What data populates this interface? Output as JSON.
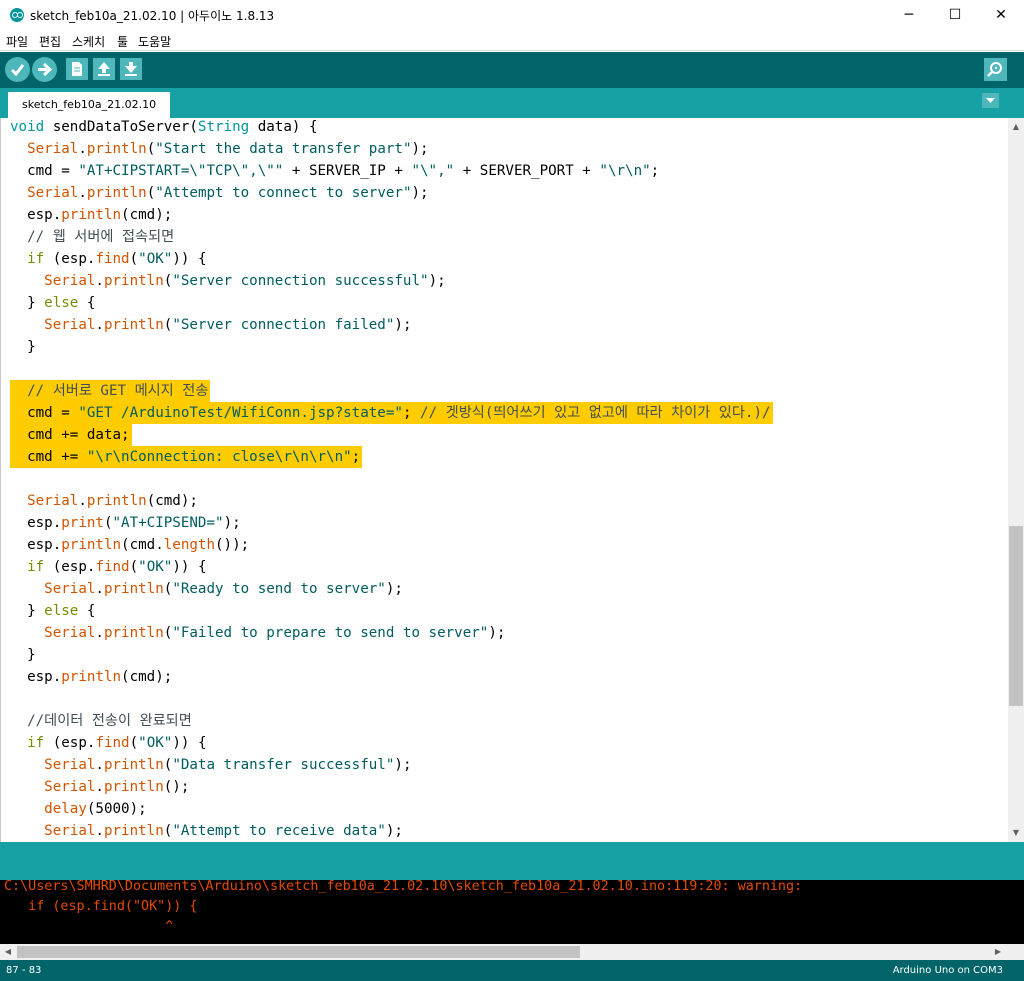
{
  "window": {
    "title": "sketch_feb10a_21.02.10 | 아두이노 1.8.13",
    "minimize": "─",
    "maximize": "☐",
    "close": "✕"
  },
  "menu": [
    "파일",
    "편집",
    "스케치",
    "툴",
    "도움말"
  ],
  "toolbar": {
    "verify_icon": "✔",
    "upload_icon": "➜",
    "new_icon": "new-file-icon",
    "open_icon": "open-icon",
    "save_icon": "save-icon",
    "serial_monitor_icon": "magnifier-icon"
  },
  "tab": {
    "label": "sketch_feb10a_21.02.10"
  },
  "code_lines": [
    [
      [
        "void",
        "#00979c"
      ],
      [
        " sendDataToServer(",
        "#000000"
      ],
      [
        "String",
        "#00979c"
      ],
      [
        " data) {",
        "#000000"
      ]
    ],
    [
      [
        "  ",
        "#000000"
      ],
      [
        "Serial",
        "#d35400"
      ],
      [
        ".",
        "#000000"
      ],
      [
        "println",
        "#d35400"
      ],
      [
        "(",
        "#000000"
      ],
      [
        "\"Start the data transfer part\"",
        "#005c5f"
      ],
      [
        ");",
        "#000000"
      ]
    ],
    [
      [
        "  cmd = ",
        "#000000"
      ],
      [
        "\"AT+CIPSTART=\\\"TCP\\\",\\\"\"",
        "#005c5f"
      ],
      [
        " + SERVER_IP + ",
        "#000000"
      ],
      [
        "\"\\\",\"",
        "#005c5f"
      ],
      [
        " + SERVER_PORT + ",
        "#000000"
      ],
      [
        "\"\\r\\n\"",
        "#005c5f"
      ],
      [
        ";",
        "#000000"
      ]
    ],
    [
      [
        "  ",
        "#000000"
      ],
      [
        "Serial",
        "#d35400"
      ],
      [
        ".",
        "#000000"
      ],
      [
        "println",
        "#d35400"
      ],
      [
        "(",
        "#000000"
      ],
      [
        "\"Attempt to connect to server\"",
        "#005c5f"
      ],
      [
        ");",
        "#000000"
      ]
    ],
    [
      [
        "  esp.",
        "#000000"
      ],
      [
        "println",
        "#d35400"
      ],
      [
        "(cmd);",
        "#000000"
      ]
    ],
    [
      [
        "  // 웹 서버에 접속되면",
        "#434f54"
      ]
    ],
    [
      [
        "  ",
        "#000000"
      ],
      [
        "if",
        "#728e00"
      ],
      [
        " (esp.",
        "#000000"
      ],
      [
        "find",
        "#d35400"
      ],
      [
        "(",
        "#000000"
      ],
      [
        "\"OK\"",
        "#005c5f"
      ],
      [
        ")) {",
        "#000000"
      ]
    ],
    [
      [
        "    ",
        "#000000"
      ],
      [
        "Serial",
        "#d35400"
      ],
      [
        ".",
        "#000000"
      ],
      [
        "println",
        "#d35400"
      ],
      [
        "(",
        "#000000"
      ],
      [
        "\"Server connection successful\"",
        "#005c5f"
      ],
      [
        ");",
        "#000000"
      ]
    ],
    [
      [
        "  } ",
        "#000000"
      ],
      [
        "else",
        "#728e00"
      ],
      [
        " {",
        "#000000"
      ]
    ],
    [
      [
        "    ",
        "#000000"
      ],
      [
        "Serial",
        "#d35400"
      ],
      [
        ".",
        "#000000"
      ],
      [
        "println",
        "#d35400"
      ],
      [
        "(",
        "#000000"
      ],
      [
        "\"Server connection failed\"",
        "#005c5f"
      ],
      [
        ");",
        "#000000"
      ]
    ],
    [
      [
        "  }",
        "#000000"
      ]
    ],
    [
      [
        "",
        "#000000"
      ]
    ],
    [
      [
        "  // 서버로 GET 메시지 전송",
        "#434f54"
      ]
    ],
    [
      [
        "  cmd = ",
        "#000000"
      ],
      [
        "\"GET /ArduinoTest/WifiConn.jsp?state=\"",
        "#005c5f"
      ],
      [
        "; ",
        "#000000"
      ],
      [
        "// 겟방식(띄어쓰기 있고 없고에 따라 차이가 있다.)/",
        "#434f54"
      ]
    ],
    [
      [
        "  cmd += data;",
        "#000000"
      ]
    ],
    [
      [
        "  cmd += ",
        "#000000"
      ],
      [
        "\"\\r\\nConnection: close\\r\\n\\r\\n\"",
        "#005c5f"
      ],
      [
        ";",
        "#000000"
      ]
    ],
    [
      [
        "",
        "#000000"
      ]
    ],
    [
      [
        "  ",
        "#000000"
      ],
      [
        "Serial",
        "#d35400"
      ],
      [
        ".",
        "#000000"
      ],
      [
        "println",
        "#d35400"
      ],
      [
        "(cmd);",
        "#000000"
      ]
    ],
    [
      [
        "  esp.",
        "#000000"
      ],
      [
        "print",
        "#d35400"
      ],
      [
        "(",
        "#000000"
      ],
      [
        "\"AT+CIPSEND=\"",
        "#005c5f"
      ],
      [
        ");",
        "#000000"
      ]
    ],
    [
      [
        "  esp.",
        "#000000"
      ],
      [
        "println",
        "#d35400"
      ],
      [
        "(cmd.",
        "#000000"
      ],
      [
        "length",
        "#d35400"
      ],
      [
        "());",
        "#000000"
      ]
    ],
    [
      [
        "  ",
        "#000000"
      ],
      [
        "if",
        "#728e00"
      ],
      [
        " (esp.",
        "#000000"
      ],
      [
        "find",
        "#d35400"
      ],
      [
        "(",
        "#000000"
      ],
      [
        "\"OK\"",
        "#005c5f"
      ],
      [
        ")) {",
        "#000000"
      ]
    ],
    [
      [
        "    ",
        "#000000"
      ],
      [
        "Serial",
        "#d35400"
      ],
      [
        ".",
        "#000000"
      ],
      [
        "println",
        "#d35400"
      ],
      [
        "(",
        "#000000"
      ],
      [
        "\"Ready to send to server\"",
        "#005c5f"
      ],
      [
        ");",
        "#000000"
      ]
    ],
    [
      [
        "  } ",
        "#000000"
      ],
      [
        "else",
        "#728e00"
      ],
      [
        " {",
        "#000000"
      ]
    ],
    [
      [
        "    ",
        "#000000"
      ],
      [
        "Serial",
        "#d35400"
      ],
      [
        ".",
        "#000000"
      ],
      [
        "println",
        "#d35400"
      ],
      [
        "(",
        "#000000"
      ],
      [
        "\"Failed to prepare to send to server\"",
        "#005c5f"
      ],
      [
        ");",
        "#000000"
      ]
    ],
    [
      [
        "  }",
        "#000000"
      ]
    ],
    [
      [
        "  esp.",
        "#000000"
      ],
      [
        "println",
        "#d35400"
      ],
      [
        "(cmd);",
        "#000000"
      ]
    ],
    [
      [
        "",
        "#000000"
      ]
    ],
    [
      [
        "  //데이터 전송이 완료되면",
        "#434f54"
      ]
    ],
    [
      [
        "  ",
        "#000000"
      ],
      [
        "if",
        "#728e00"
      ],
      [
        " (esp.",
        "#000000"
      ],
      [
        "find",
        "#d35400"
      ],
      [
        "(",
        "#000000"
      ],
      [
        "\"OK\"",
        "#005c5f"
      ],
      [
        ")) {",
        "#000000"
      ]
    ],
    [
      [
        "    ",
        "#000000"
      ],
      [
        "Serial",
        "#d35400"
      ],
      [
        ".",
        "#000000"
      ],
      [
        "println",
        "#d35400"
      ],
      [
        "(",
        "#000000"
      ],
      [
        "\"Data transfer successful\"",
        "#005c5f"
      ],
      [
        ");",
        "#000000"
      ]
    ],
    [
      [
        "    ",
        "#000000"
      ],
      [
        "Serial",
        "#d35400"
      ],
      [
        ".",
        "#000000"
      ],
      [
        "println",
        "#d35400"
      ],
      [
        "();",
        "#000000"
      ]
    ],
    [
      [
        "    ",
        "#000000"
      ],
      [
        "delay",
        "#d35400"
      ],
      [
        "(5000);",
        "#000000"
      ]
    ],
    [
      [
        "    ",
        "#000000"
      ],
      [
        "Serial",
        "#d35400"
      ],
      [
        ".",
        "#000000"
      ],
      [
        "println",
        "#d35400"
      ],
      [
        "(",
        "#000000"
      ],
      [
        "\"Attempt to receive data\"",
        "#005c5f"
      ],
      [
        ");",
        "#000000"
      ]
    ]
  ],
  "selection": {
    "color": "#ffcc00"
  },
  "console": {
    "lines": [
      "C:\\Users\\SMHRD\\Documents\\Arduino\\sketch_feb10a_21.02.10\\sketch_feb10a_21.02.10.ino:119:20: warning:",
      "   if (esp.find(\"OK\")) {",
      "                    ^"
    ],
    "text_color": "#e34c00"
  },
  "status": {
    "line_range": "87 - 83",
    "board": "Arduino Uno on COM3"
  },
  "colors": {
    "toolbar_bg": "#006468",
    "tab_bar_bg": "#17a1a5",
    "button_bg": "#4db7bb"
  }
}
